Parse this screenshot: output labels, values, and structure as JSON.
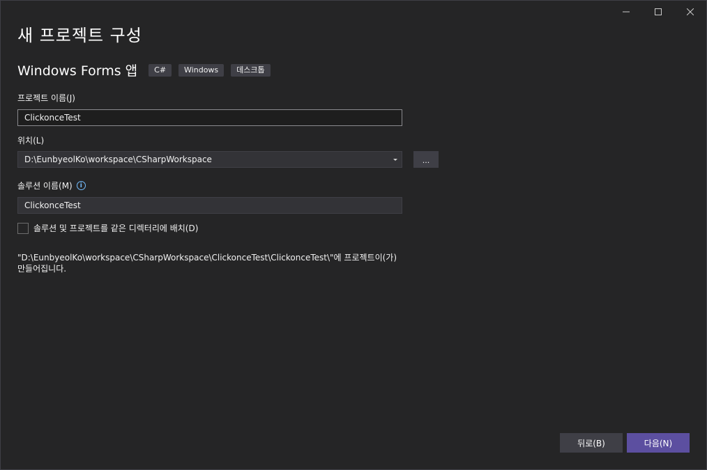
{
  "window": {
    "minimize_icon": "minimize-icon",
    "maximize_icon": "maximize-icon",
    "close_icon": "close-icon"
  },
  "dialog": {
    "title": "새 프로젝트 구성"
  },
  "template": {
    "name": "Windows Forms 앱",
    "tags": [
      "C#",
      "Windows",
      "데스크톱"
    ]
  },
  "project_name": {
    "label": "프로젝트 이름(J)",
    "value": "ClickonceTest"
  },
  "location": {
    "label": "위치(L)",
    "value": "D:\\EunbyeolKo\\workspace\\CSharpWorkspace",
    "browse_label": "..."
  },
  "solution_name": {
    "label": "솔루션 이름(M)",
    "value": "ClickonceTest",
    "info_icon": "info-icon"
  },
  "same_directory": {
    "label": "솔루션 및 프로젝트를 같은 디렉터리에 배치(D)",
    "checked": false
  },
  "note": {
    "text": "\"D:\\EunbyeolKo\\workspace\\CSharpWorkspace\\ClickonceTest\\ClickonceTest\\\"에 프로젝트이(가) 만들어집니다."
  },
  "footer": {
    "back_label": "뒤로(B)",
    "next_label": "다음(N)"
  },
  "colors": {
    "background": "#252526",
    "input_bg": "#333337",
    "button_bg": "#3f3f46",
    "primary_button": "#5c4fa0",
    "info_icon": "#75beff"
  }
}
